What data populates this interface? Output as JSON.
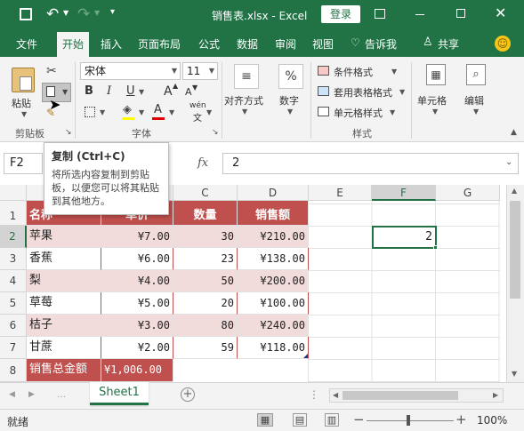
{
  "title_bar": {
    "title": "销售表.xlsx - Excel",
    "login_label": "登录",
    "colors": {
      "brand": "#217346"
    }
  },
  "tabs": [
    {
      "label": "文件"
    },
    {
      "label": "开始"
    },
    {
      "label": "插入"
    },
    {
      "label": "页面布局"
    },
    {
      "label": "公式"
    },
    {
      "label": "数据"
    },
    {
      "label": "审阅"
    },
    {
      "label": "视图"
    }
  ],
  "tell_me": "告诉我",
  "share": "共享",
  "ribbon": {
    "paste": "粘贴",
    "clipboard_group": "剪贴板",
    "font_name": "宋体",
    "font_size": "11",
    "font_group": "字体",
    "wen": "wén",
    "wen_char": "文",
    "align_label": "对齐方式",
    "number_label": "数字",
    "percent_icon": "%",
    "cond_format": "条件格式",
    "table_format": "套用表格格式",
    "cell_style": "单元格样式",
    "style_group": "样式",
    "cells_label": "单元格",
    "edit_label": "编辑",
    "bold": "B",
    "italic": "I",
    "underline": "U",
    "grow": "A",
    "shrink": "A",
    "fontcolor": "A"
  },
  "tooltip": {
    "title": "复制 (Ctrl+C)",
    "body": "将所选内容复制到剪贴板，以便您可以将其粘贴到其他地方。"
  },
  "formula_bar": {
    "name_box": "F2",
    "fx": "fx",
    "value": "2"
  },
  "columns": [
    "A",
    "B",
    "C",
    "D",
    "E",
    "F",
    "G"
  ],
  "rows": [
    "1",
    "2",
    "3",
    "4",
    "5",
    "6",
    "7",
    "8"
  ],
  "sheet": {
    "headers": [
      "名称",
      "单价",
      "数量",
      "销售额"
    ],
    "data": [
      [
        "苹果",
        "¥7.00",
        "30",
        "¥210.00"
      ],
      [
        "香蕉",
        "¥6.00",
        "23",
        "¥138.00"
      ],
      [
        "梨",
        "¥4.00",
        "50",
        "¥200.00"
      ],
      [
        "草莓",
        "¥5.00",
        "20",
        "¥100.00"
      ],
      [
        "桔子",
        "¥3.00",
        "80",
        "¥240.00"
      ],
      [
        "甘蔗",
        "¥2.00",
        "59",
        "¥118.00"
      ]
    ],
    "total_label": "销售总金额",
    "total_value": "¥1,006.00",
    "f2_value": "2",
    "colors": {
      "header": "#c0504d",
      "band": "#f2dcdb",
      "total": "#c0504d"
    }
  },
  "sheet_tab": "Sheet1",
  "status": {
    "text": "就绪",
    "zoom": "100%"
  }
}
